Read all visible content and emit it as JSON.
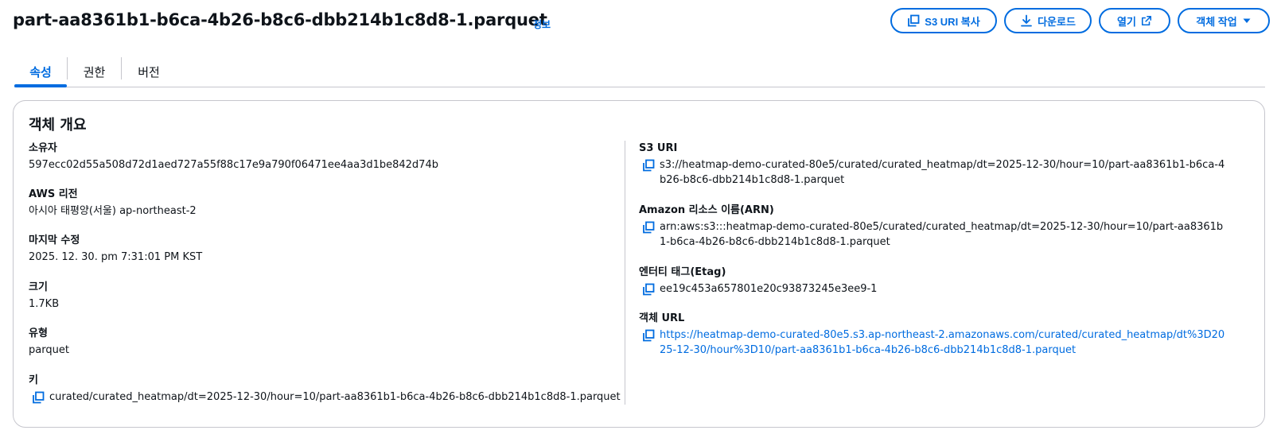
{
  "header": {
    "title": "part-aa8361b1-b6ca-4b26-b8c6-dbb214b1c8d8-1.parquet",
    "info": "정보"
  },
  "actions": {
    "copy_uri": "S3 URI 복사",
    "download": "다운로드",
    "open": "열기",
    "object_actions": "객체 작업"
  },
  "tabs": [
    "속성",
    "권한",
    "버전"
  ],
  "overview": {
    "title": "객체 개요",
    "left": [
      {
        "label": "소유자",
        "value": "597ecc02d55a508d72d1aed727a55f88c17e9a790f06471ee4aa3d1be842d74b"
      },
      {
        "label": "AWS 리전",
        "value": "아시아 태평양(서울) ap-northeast-2"
      },
      {
        "label": "마지막 수정",
        "value": "2025. 12. 30. pm 7:31:01 PM KST"
      },
      {
        "label": "크기",
        "value": "1.7KB"
      },
      {
        "label": "유형",
        "value": "parquet"
      },
      {
        "label": "키",
        "value": "curated/curated_heatmap/dt=2025-12-30/hour=10/part-aa8361b1-b6ca-4b26-b8c6-dbb214b1c8d8-1.parquet"
      }
    ],
    "right": [
      {
        "label": "S3 URI",
        "value": "s3://heatmap-demo-curated-80e5/curated/curated_heatmap/dt=2025-12-30/hour=10/part-aa8361b1-b6ca-4b26-b8c6-dbb214b1c8d8-1.parquet"
      },
      {
        "label": "Amazon 리소스 이름(ARN)",
        "value": "arn:aws:s3:::heatmap-demo-curated-80e5/curated/curated_heatmap/dt=2025-12-30/hour=10/part-aa8361b1-b6ca-4b26-b8c6-dbb214b1c8d8-1.parquet"
      },
      {
        "label": "엔터티 태그(Etag)",
        "value": "ee19c453a657801e20c93873245e3ee9-1"
      },
      {
        "label": "객체 URL",
        "value": "https://heatmap-demo-curated-80e5.s3.ap-northeast-2.amazonaws.com/curated/curated_heatmap/dt%3D2025-12-30/hour%3D10/part-aa8361b1-b6ca-4b26-b8c6-dbb214b1c8d8-1.parquet"
      }
    ]
  },
  "colors": {
    "accent": "#006ce0",
    "text": "#0f141a",
    "border": "#c6c6cd"
  },
  "icons": {
    "copy": "copy-icon",
    "download": "download-icon",
    "external": "external-link-icon",
    "caret": "caret-down-icon"
  }
}
